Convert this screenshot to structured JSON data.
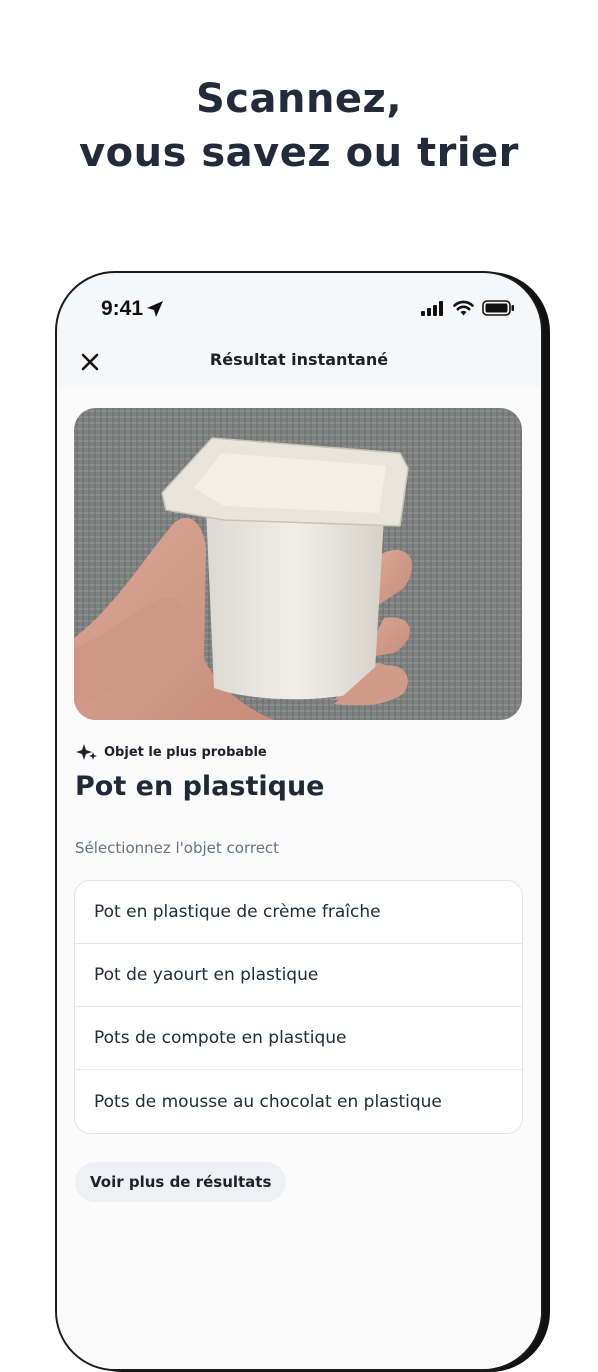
{
  "headline": {
    "line1": "Scannez,",
    "line2": "vous savez ou trier"
  },
  "status_bar": {
    "time": "9:41",
    "icons": [
      "location-arrow-icon",
      "signal-icon",
      "wifi-icon",
      "battery-icon"
    ]
  },
  "nav": {
    "title": "Résultat instantané",
    "close_icon": "close-icon"
  },
  "result": {
    "probable_label": "Objet le plus probable",
    "probable_icon": "sparkle-icon",
    "object_title": "Pot en plastique",
    "select_label": "Sélectionnez l'objet correct",
    "options": [
      "Pot en plastique de crème fraîche",
      "Pot de yaourt en plastique",
      "Pots de compote en plastique",
      "Pots de mousse au chocolat en plastique"
    ],
    "more_button": "Voir plus de résultats"
  },
  "colors": {
    "headline": "#232b3a",
    "text": "#1f2937",
    "muted": "#6b7280",
    "chip_bg": "#eef0f3"
  }
}
